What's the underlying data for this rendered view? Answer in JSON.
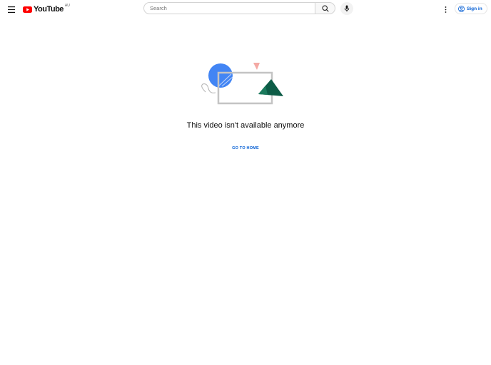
{
  "masthead": {
    "logo_text": "YouTube",
    "country_code": "AU",
    "search_placeholder": "Search",
    "signin_label": "Sign in",
    "icons": {
      "menu": "hamburger-menu-icon",
      "search": "search-icon",
      "mic": "microphone-icon",
      "more": "more-vert-icon",
      "account": "account-circle-icon"
    }
  },
  "main": {
    "message": "This video isn't available anymore",
    "home_button_label": "GO TO HOME"
  },
  "colors": {
    "brand_red": "#ff0000",
    "link_blue": "#065fd4",
    "illustration_blue": "#4285f4",
    "illustration_green": "#0d5c46",
    "illustration_pink": "#f4a9a4",
    "illustration_frame": "#c4c4c4"
  }
}
